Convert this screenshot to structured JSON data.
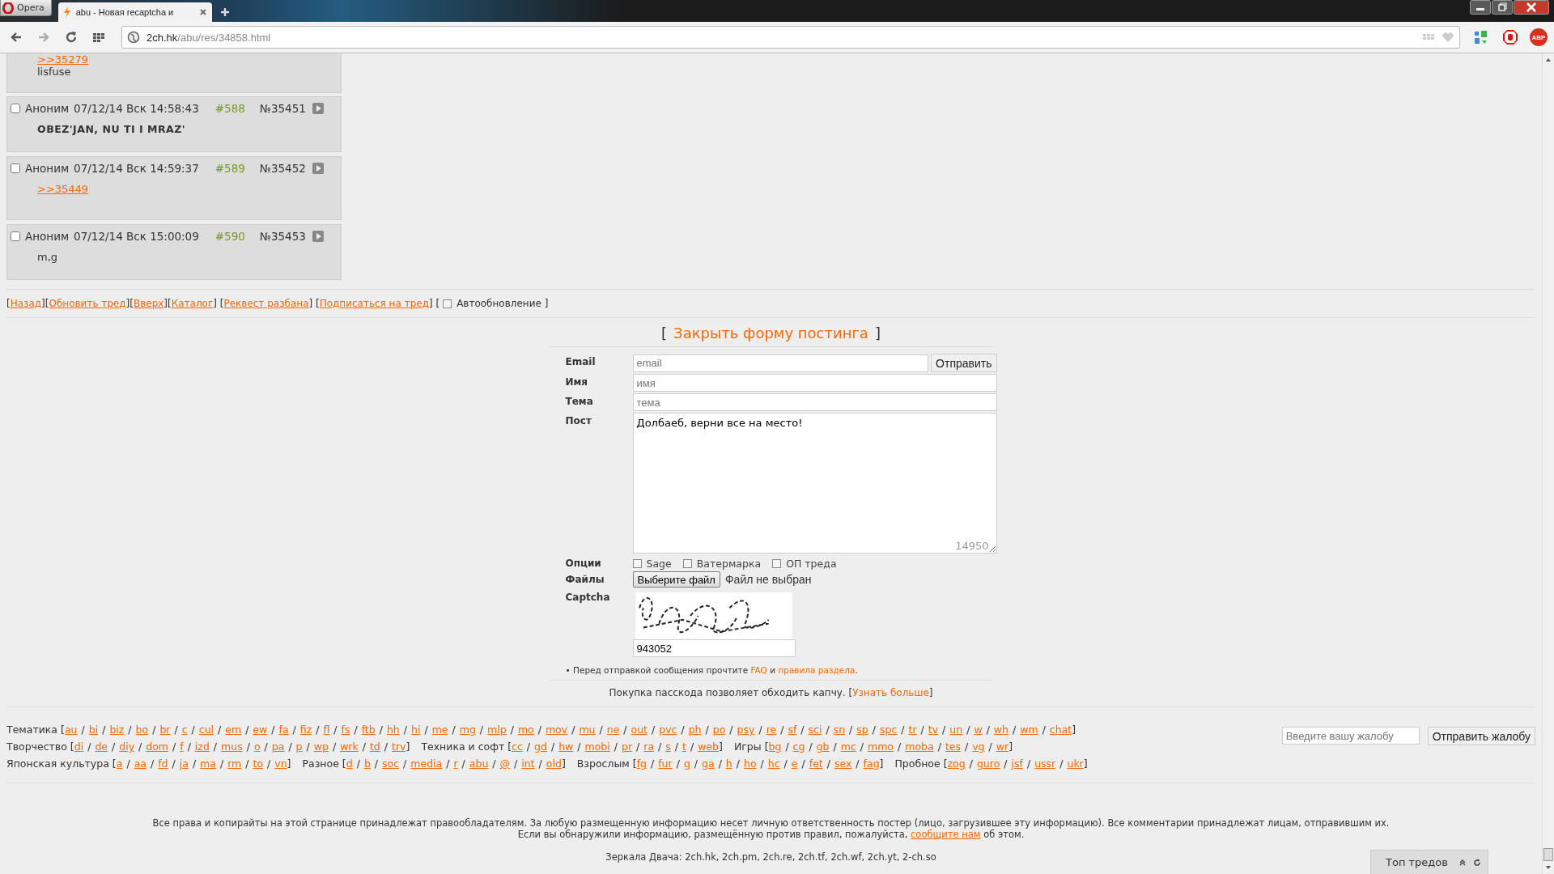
{
  "browser": {
    "menu_button": "Opera",
    "tab": {
      "title": "abu - Новая recaptcha и",
      "selected": true
    },
    "url_host": "2ch.hk",
    "url_path": "/abu/res/34858.html",
    "extension_badge": "ABP"
  },
  "posts": [
    {
      "partial": true,
      "body": [
        {
          "kind": "reply_link",
          "text": ">>35279"
        },
        {
          "kind": "text",
          "text": "lisfuse"
        }
      ]
    },
    {
      "partial": false,
      "checked": false,
      "name": "Аноним",
      "date": "07/12/14 Вск 14:58:43",
      "number": "#588",
      "id": "№35451",
      "body": [
        {
          "kind": "bold",
          "text": "OBEZ'JAN, NU TI I MRAZ'"
        }
      ]
    },
    {
      "partial": false,
      "checked": false,
      "name": "Аноним",
      "date": "07/12/14 Вск 14:59:37",
      "number": "#589",
      "id": "№35452",
      "body": [
        {
          "kind": "reply_link",
          "text": ">>35449"
        }
      ]
    },
    {
      "partial": false,
      "checked": false,
      "name": "Аноним",
      "date": "07/12/14 Вск 15:00:09",
      "number": "#590",
      "id": "№35453",
      "body": [
        {
          "kind": "text",
          "text": "m,g"
        }
      ]
    }
  ],
  "thread_nav": [
    {
      "kind": "text",
      "text": "["
    },
    {
      "kind": "link",
      "text": "Назад"
    },
    {
      "kind": "text",
      "text": "]["
    },
    {
      "kind": "link",
      "text": "Обновить тред"
    },
    {
      "kind": "text",
      "text": "]["
    },
    {
      "kind": "link",
      "text": "Вверх"
    },
    {
      "kind": "text",
      "text": "]["
    },
    {
      "kind": "link",
      "text": "Каталог"
    },
    {
      "kind": "text",
      "text": "] ["
    },
    {
      "kind": "link",
      "text": "Реквест разбана"
    },
    {
      "kind": "text",
      "text": "] ["
    },
    {
      "kind": "link",
      "text": "Подписаться на тред"
    },
    {
      "kind": "text",
      "text": "] ["
    },
    {
      "kind": "checkbox",
      "text": "Автообновление",
      "checked": false
    },
    {
      "kind": "text",
      "text": "]"
    }
  ],
  "form": {
    "toggle": {
      "open": "[",
      "label": "Закрыть форму постинга",
      "close": "]"
    },
    "email": {
      "label": "Email",
      "placeholder": "email",
      "submit": "Отправить"
    },
    "name": {
      "label": "Имя",
      "placeholder": "имя"
    },
    "subject": {
      "label": "Тема",
      "placeholder": "тема"
    },
    "post": {
      "label": "Пост",
      "value": "Долбаеб, верни все на место!",
      "counter": "14950"
    },
    "options": {
      "label": "Опции",
      "items": [
        {
          "label": "Sage",
          "checked": false
        },
        {
          "label": "Ватермарка",
          "checked": false
        },
        {
          "label": "ОП треда",
          "checked": false
        }
      ]
    },
    "files": {
      "label": "Файлы",
      "button": "Выберите файл",
      "status": "Файл не выбран"
    },
    "captcha": {
      "label": "Captcha",
      "value": "943052"
    },
    "note": [
      {
        "kind": "text",
        "text": "• Перед отправкой сообщения прочтите "
      },
      {
        "kind": "link",
        "text": "FAQ"
      },
      {
        "kind": "text",
        "text": " и "
      },
      {
        "kind": "link",
        "text": "правила раздела"
      },
      {
        "kind": "text",
        "text": "."
      }
    ],
    "passcode": [
      {
        "kind": "text",
        "text": "Покупка пасскода позволяет обходить капчу. ["
      },
      {
        "kind": "link",
        "text": "Узнать больше"
      },
      {
        "kind": "text",
        "text": "]"
      }
    ]
  },
  "board_nav": {
    "open": "[",
    "close": "]",
    "separator": "/",
    "rows": [
      [
        {
          "label": "Тематика",
          "boards": [
            "au",
            "bi",
            "biz",
            "bo",
            "br",
            "c",
            "cul",
            "em",
            "ew",
            "fa",
            "fiz",
            "fl",
            "fs",
            "ftb",
            "hh",
            "hi",
            "me",
            "mg",
            "mlp",
            "mo",
            "mov",
            "mu",
            "ne",
            "out",
            "pvc",
            "ph",
            "po",
            "psy",
            "re",
            "sf",
            "sci",
            "sn",
            "sp",
            "spc",
            "tr",
            "tv",
            "un",
            "w",
            "wh",
            "wm",
            "chat"
          ]
        }
      ],
      [
        {
          "label": "Творчество",
          "boards": [
            "di",
            "de",
            "diy",
            "dom",
            "f",
            "izd",
            "mus",
            "o",
            "pa",
            "p",
            "wp",
            "wrk",
            "td",
            "trv"
          ]
        },
        {
          "label": "Техника и софт",
          "boards": [
            "cc",
            "gd",
            "hw",
            "mobi",
            "pr",
            "ra",
            "s",
            "t",
            "web"
          ]
        },
        {
          "label": "Игры",
          "boards": [
            "bg",
            "cg",
            "gb",
            "mc",
            "mmo",
            "moba",
            "tes",
            "vg",
            "wr"
          ]
        }
      ],
      [
        {
          "label": "Японская культура",
          "boards": [
            "a",
            "aa",
            "fd",
            "ja",
            "ma",
            "rm",
            "to",
            "vn"
          ]
        },
        {
          "label": "Разное",
          "boards": [
            "d",
            "b",
            "soc",
            "media",
            "r",
            "abu",
            "@",
            "int",
            "old"
          ]
        },
        {
          "label": "Взрослым",
          "boards": [
            "fg",
            "fur",
            "g",
            "ga",
            "h",
            "ho",
            "hc",
            "e",
            "fet",
            "sex",
            "fag"
          ]
        },
        {
          "label": "Пробное",
          "boards": [
            "zog",
            "guro",
            "jsf",
            "ussr",
            "ukr"
          ]
        }
      ]
    ]
  },
  "complaint": {
    "placeholder": "Введите вашу жалобу",
    "button": "Отправить жалобу"
  },
  "footer": {
    "rights": "Все права и копирайты на этой странице принадлежат правообладателям. За любую размещенную информацию несет личную ответственность постер (лицо, загрузившее эту информацию). Все комментарии принадлежат лицам, отправившим их.",
    "report": [
      {
        "kind": "text",
        "text": "Если вы обнаружили информацию, размещённую против правил, пожалуйста, "
      },
      {
        "kind": "link",
        "text": "сообщите нам"
      },
      {
        "kind": "text",
        "text": " об этом."
      }
    ],
    "mirrors": "Зеркала Двача: 2ch.hk, 2ch.pm, 2ch.re, 2ch.tf, 2ch.wf, 2ch.yt, 2-ch.so"
  },
  "top_threads": {
    "label": "Топ тредов"
  }
}
